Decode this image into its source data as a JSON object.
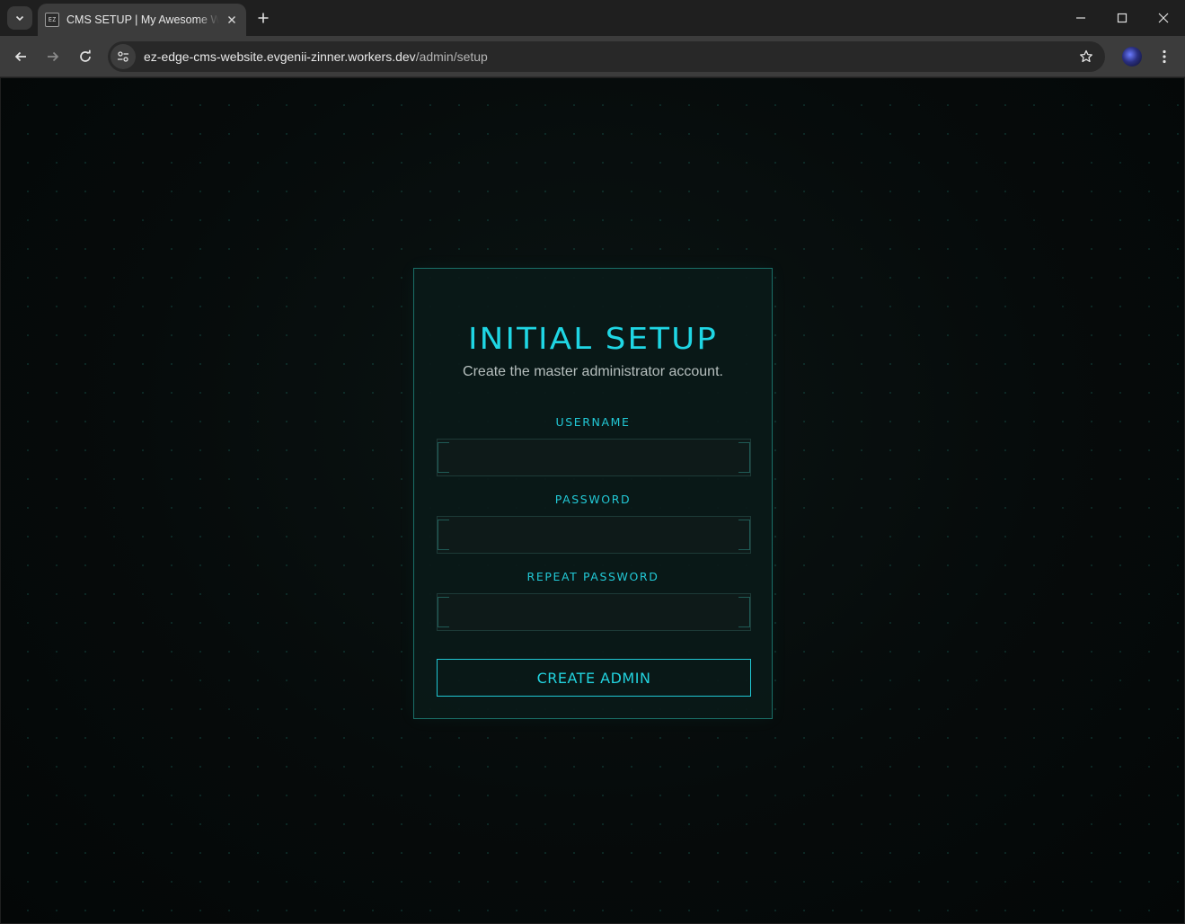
{
  "browser": {
    "tab_title": "CMS SETUP | My Awesome Website",
    "favicon_text": "EZ",
    "url_host": "ez-edge-cms-website.evgenii-zinner.workers.dev",
    "url_path": "/admin/setup",
    "icons": {
      "tab_list": "chevron-down-icon",
      "tab_close": "close-icon",
      "new_tab": "plus-icon",
      "minimize": "minimize-icon",
      "maximize": "maximize-icon",
      "close_window": "close-icon",
      "back": "arrow-left-icon",
      "forward": "arrow-right-icon",
      "reload": "reload-icon",
      "site_info": "tune-icon",
      "bookmark": "star-icon",
      "menu": "kebab-menu-icon"
    }
  },
  "setup": {
    "title": "INITIAL SETUP",
    "subtitle": "Create the master administrator account.",
    "username_label": "USERNAME",
    "username_value": "",
    "password_label": "PASSWORD",
    "password_value": "",
    "repeat_password_label": "REPEAT PASSWORD",
    "repeat_password_value": "",
    "submit_label": "CREATE ADMIN"
  },
  "colors": {
    "accent": "#1fd6e4",
    "page_background": "#050a0a",
    "card_border": "#1a6f68",
    "subtitle_text": "#b6bfbe"
  }
}
